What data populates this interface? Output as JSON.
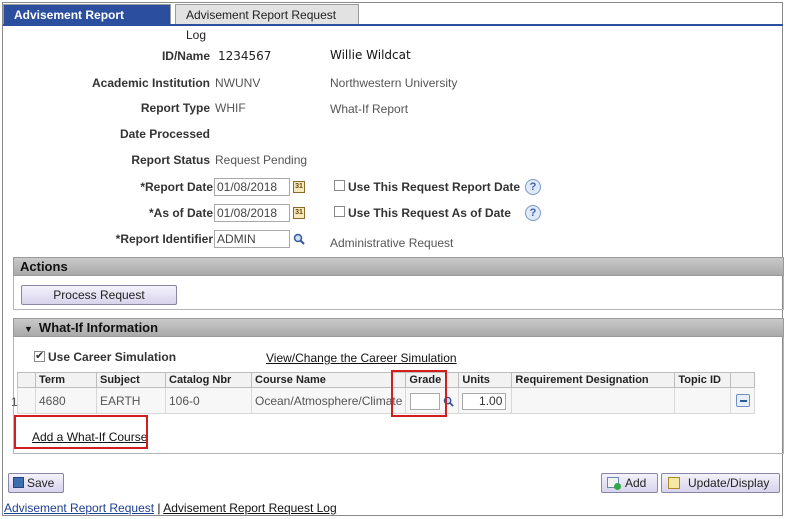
{
  "tabs": [
    {
      "label": "Advisement Report Request",
      "active": true
    },
    {
      "label": "Advisement Report Request Log",
      "active": false
    }
  ],
  "fields": {
    "id_name_label": "ID/Name",
    "id_value": "1234567",
    "name_value": "Willie Wildcat",
    "institution_label": "Academic Institution",
    "institution_code": "NWUNV",
    "institution_name": "Northwestern University",
    "report_type_label": "Report Type",
    "report_type_code": "WHIF",
    "report_type_name": "What-If Report",
    "date_processed_label": "Date Processed",
    "report_status_label": "Report Status",
    "report_status_value": "Request Pending",
    "report_date_label": "*Report Date",
    "report_date_value": "01/08/2018",
    "use_request_report_date_label": "Use This Request Report Date",
    "as_of_date_label": "*As of Date",
    "as_of_date_value": "01/08/2018",
    "use_request_as_of_date_label": "Use This Request As of Date",
    "report_identifier_label": "*Report Identifier",
    "report_identifier_value": "ADMIN",
    "report_identifier_desc": "Administrative Request"
  },
  "actions": {
    "header": "Actions",
    "process_button": "Process Request"
  },
  "whatif": {
    "header": "What-If Information",
    "use_career_sim_label": "Use Career Simulation",
    "use_career_sim_checked": true,
    "view_change_link": "View/Change the Career Simulation",
    "columns": [
      "Term",
      "Subject",
      "Catalog Nbr",
      "Course Name",
      "Grade",
      "Units",
      "Requirement Designation",
      "Topic ID"
    ],
    "rows": [
      {
        "row_num": "1",
        "term": "4680",
        "subject": "EARTH",
        "catalog": "106-0",
        "course_name": "Ocean/Atmosphere/Climate",
        "grade": "",
        "units": "1.00",
        "req_designation": "",
        "topic_id": ""
      }
    ],
    "add_course_link": "Add a What-If Course"
  },
  "toolbar": {
    "save_label": "Save",
    "add_label": "Add",
    "update_label": "Update/Display"
  },
  "footer": {
    "link1": "Advisement Report Request",
    "separator": "|",
    "link2": "Advisement Report Request Log"
  },
  "colors": {
    "tab_active_bg": "#2b4f9e",
    "highlight_red": "#d21e1e",
    "section_bar": "#b5b5b5"
  }
}
